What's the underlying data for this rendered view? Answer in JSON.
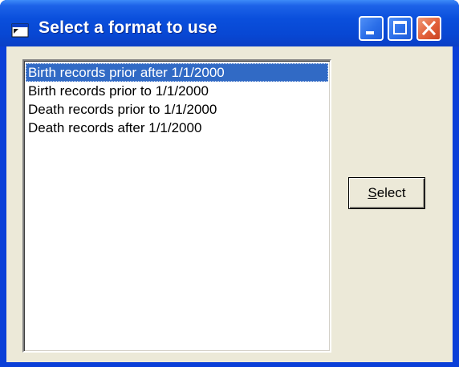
{
  "window": {
    "title": "Select a format to use",
    "icon": "app-window-icon",
    "controls": {
      "minimize_icon": "minimize-icon",
      "maximize_icon": "maximize-icon",
      "close_icon": "close-icon"
    }
  },
  "listbox": {
    "items": [
      {
        "label": "Birth records prior after 1/1/2000",
        "selected": true
      },
      {
        "label": "Birth records prior to 1/1/2000",
        "selected": false
      },
      {
        "label": "Death records prior to 1/1/2000",
        "selected": false
      },
      {
        "label": "Death records after 1/1/2000",
        "selected": false
      }
    ]
  },
  "buttons": {
    "select_accel": "S",
    "select_rest": "elect"
  },
  "colors": {
    "titlebar": "#0a4fdc",
    "selection": "#316ac5",
    "face": "#ece9d8",
    "close": "#e2603a"
  }
}
